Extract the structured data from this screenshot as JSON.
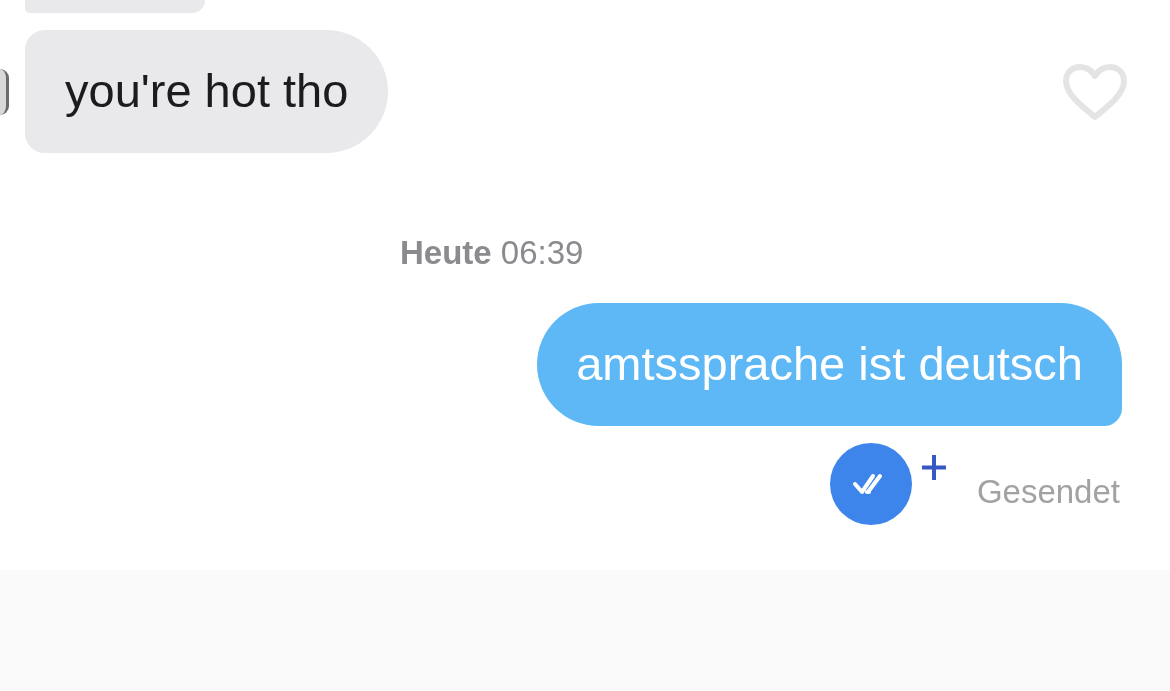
{
  "conversation": {
    "items": [
      {
        "kind": "incoming",
        "text": "you're hot tho",
        "liked": false
      },
      {
        "kind": "timestamp",
        "day": "Heute",
        "time": "06:39"
      },
      {
        "kind": "outgoing",
        "text": "amtssprache ist deutsch",
        "status": "Gesendet"
      }
    ]
  }
}
